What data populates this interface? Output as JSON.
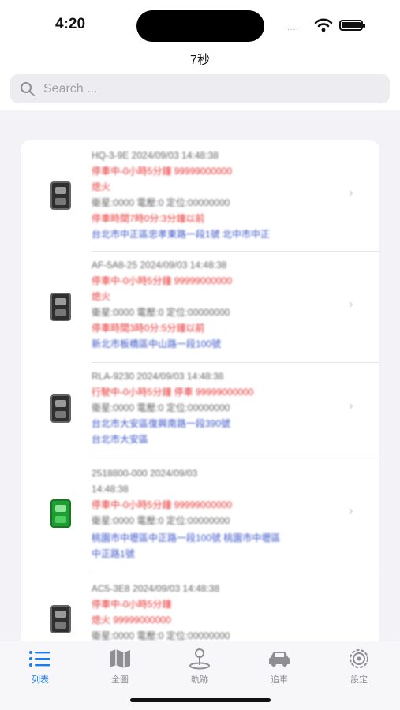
{
  "status_bar": {
    "time": "4:20",
    "signal": "....",
    "icons": [
      "wifi-icon",
      "battery-icon"
    ]
  },
  "header": {
    "title": "7秒"
  },
  "search": {
    "placeholder": "Search ..."
  },
  "list": {
    "items": [
      {
        "icon": "car-icon",
        "icon_color": "#2f2f2f",
        "lines": [
          {
            "text": "HQ-3-9E 2024/09/03 14:48:38",
            "color": "gray"
          },
          {
            "text": "停車中-0小時5分鐘     99999000000",
            "color": "red"
          },
          {
            "text": "熄火",
            "color": "red"
          },
          {
            "text": "衛星:0000 電壓:0 定位:00000000",
            "color": "gray"
          },
          {
            "text": "停車時間7時0分:3分鐘以前",
            "color": "red"
          },
          {
            "text": "台北市中正區忠孝東路一段1號 北中市中正",
            "color": "blue"
          }
        ]
      },
      {
        "icon": "car-icon",
        "icon_color": "#2f2f2f",
        "lines": [
          {
            "text": "AF-5A8-25 2024/09/03 14:48:38",
            "color": "gray"
          },
          {
            "text": "停車中-0小時5分鐘     99999000000",
            "color": "red"
          },
          {
            "text": "熄火",
            "color": "red"
          },
          {
            "text": "衛星:0000 電壓:0 定位:00000000",
            "color": "gray"
          },
          {
            "text": "停車時間3時0分:5分鐘以前",
            "color": "red"
          },
          {
            "text": "新北市板橋區中山路一段100號",
            "color": "blue"
          }
        ]
      },
      {
        "icon": "car-icon",
        "icon_color": "#2f2f2f",
        "lines": [
          {
            "text": "RLA-9230 2024/09/03 14:48:38",
            "color": "gray"
          },
          {
            "text": "行駛中-0小時5分鐘 停車     99999000000",
            "color": "red"
          },
          {
            "text": "衛星:0000 電壓:0 定位:00000000",
            "color": "gray"
          },
          {
            "text": "台北市大安區復興南路一段390號",
            "color": "blue"
          },
          {
            "text": "台北市大安區",
            "color": "blue"
          }
        ]
      },
      {
        "icon": "car-icon",
        "icon_color": "#1f9d33",
        "lines": [
          {
            "text": "2518800-000 2024/09/03",
            "color": "gray"
          },
          {
            "text": "14:48:38",
            "color": "gray"
          },
          {
            "text": "停車中-0小時5分鐘     99999000000",
            "color": "red"
          },
          {
            "text": "衛星:0000 電壓:0 定位:00000000",
            "color": "gray"
          },
          {
            "text": "桃園市中壢區中正路一段100號 桃園市中壢區",
            "color": "blue"
          },
          {
            "text": "中正路1號",
            "color": "blue"
          }
        ]
      },
      {
        "icon": "car-icon",
        "icon_color": "#2f2f2f",
        "lines": [
          {
            "text": "AC5-3E8 2024/09/03 14:48:38",
            "color": "gray"
          },
          {
            "text": "停車中-0小時5分鐘",
            "color": "red"
          },
          {
            "text": "熄火     99999000000",
            "color": "red"
          },
          {
            "text": "衛星:0000 電壓:0 定位:00000000",
            "color": "gray"
          }
        ]
      }
    ]
  },
  "tabs": [
    {
      "label": "列表",
      "icon": "list-icon",
      "active": true
    },
    {
      "label": "全圖",
      "icon": "map-icon",
      "active": false
    },
    {
      "label": "軌跡",
      "icon": "location-pin-icon",
      "active": false
    },
    {
      "label": "追車",
      "icon": "car-icon",
      "active": false
    },
    {
      "label": "設定",
      "icon": "gear-icon",
      "active": false
    }
  ],
  "colors": {
    "accent": "#1a7cf0",
    "alert": "#e83030",
    "address": "#3a55c8",
    "text_muted": "#666666"
  }
}
